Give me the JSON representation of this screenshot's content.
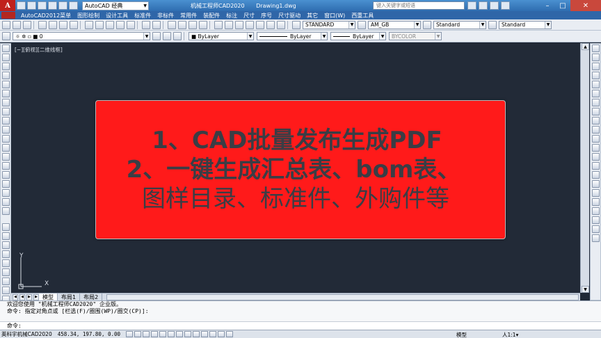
{
  "title_bar": {
    "logo": "A",
    "workspace": "AutoCAD 经典",
    "app_name": "机械工程师CAD2020",
    "file_name": "Drawing1.dwg",
    "search_placeholder": "键入关键字或短语"
  },
  "menu": {
    "items": [
      "AutoCAD2012菜单",
      "图形绘制",
      "设计工具",
      "标准件",
      "非标件",
      "常用件",
      "装配件",
      "标注",
      "尺寸",
      "序号",
      "尺寸驱动",
      "其它",
      "窗口(W)",
      "西重工具"
    ]
  },
  "toolbar1": {
    "text_style": "STANDARD",
    "dim_style": "AM_GB",
    "table_style": "Standard",
    "multileader_style": "Standard"
  },
  "toolbar2": {
    "layer": "0",
    "color": "ByLayer",
    "linetype": "ByLayer",
    "lineweight": "ByLayer",
    "plot_style": "BYCOLOR"
  },
  "canvas": {
    "viewport_label": "[−][俯视][二维线框]",
    "banner": {
      "line1": "1、CAD批量发布生成PDF",
      "line2": "2、一键生成汇总表、bom表、",
      "line3": "图样目录、标准件、外购件等"
    },
    "ucs": {
      "x": "X",
      "y": "Y"
    }
  },
  "tabs": [
    "模型",
    "布局1",
    "布局2"
  ],
  "command": {
    "history": [
      "欢迎您使用 \"机械工程师CAD2020\" 企业版。",
      "命令: 指定对角点或 [栏选(F)/圈围(WP)/圈交(CP)]:"
    ],
    "prompt": "命令:"
  },
  "status": {
    "brand": "英科宇机械CAD2020",
    "coords": "458.34, 197.80, 0.00",
    "model": "模型",
    "scale": "人1:1▾"
  }
}
